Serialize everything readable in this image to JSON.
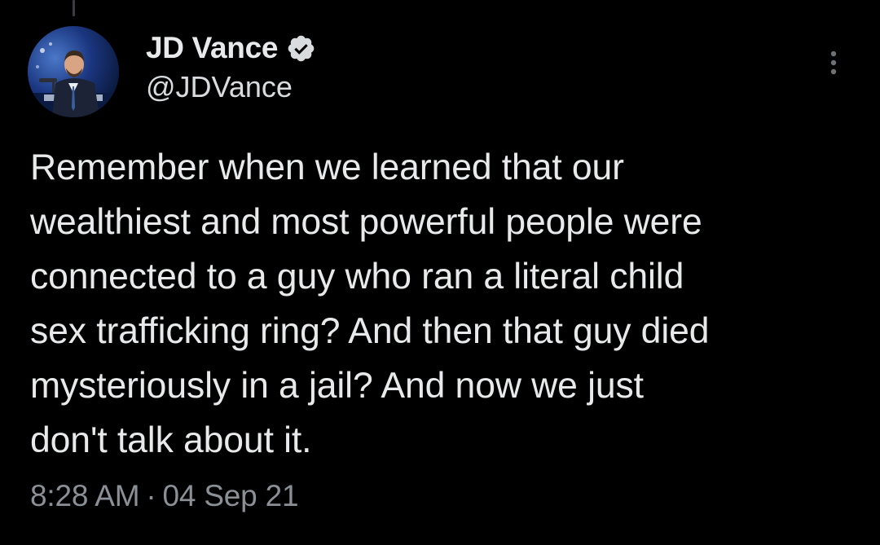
{
  "tweet": {
    "author": {
      "display_name": "JD Vance",
      "handle": "@JDVance",
      "verified": true,
      "avatar_icon": "profile-photo"
    },
    "text": "Remember when we learned that our\nwealthiest and most powerful people were\nconnected to a guy who ran a literal child\nsex trafficking ring? And then that guy died\nmysteriously in a jail? And now we just\ndon't talk about it.",
    "time": "8:28 AM",
    "separator": "·",
    "date": "04 Sep 21",
    "more_icon": "more-vertical-icon"
  },
  "colors": {
    "background": "#000000",
    "text": "#e7e9ea",
    "secondary": "#8b9097",
    "verified_badge": "#d9dcdf"
  }
}
